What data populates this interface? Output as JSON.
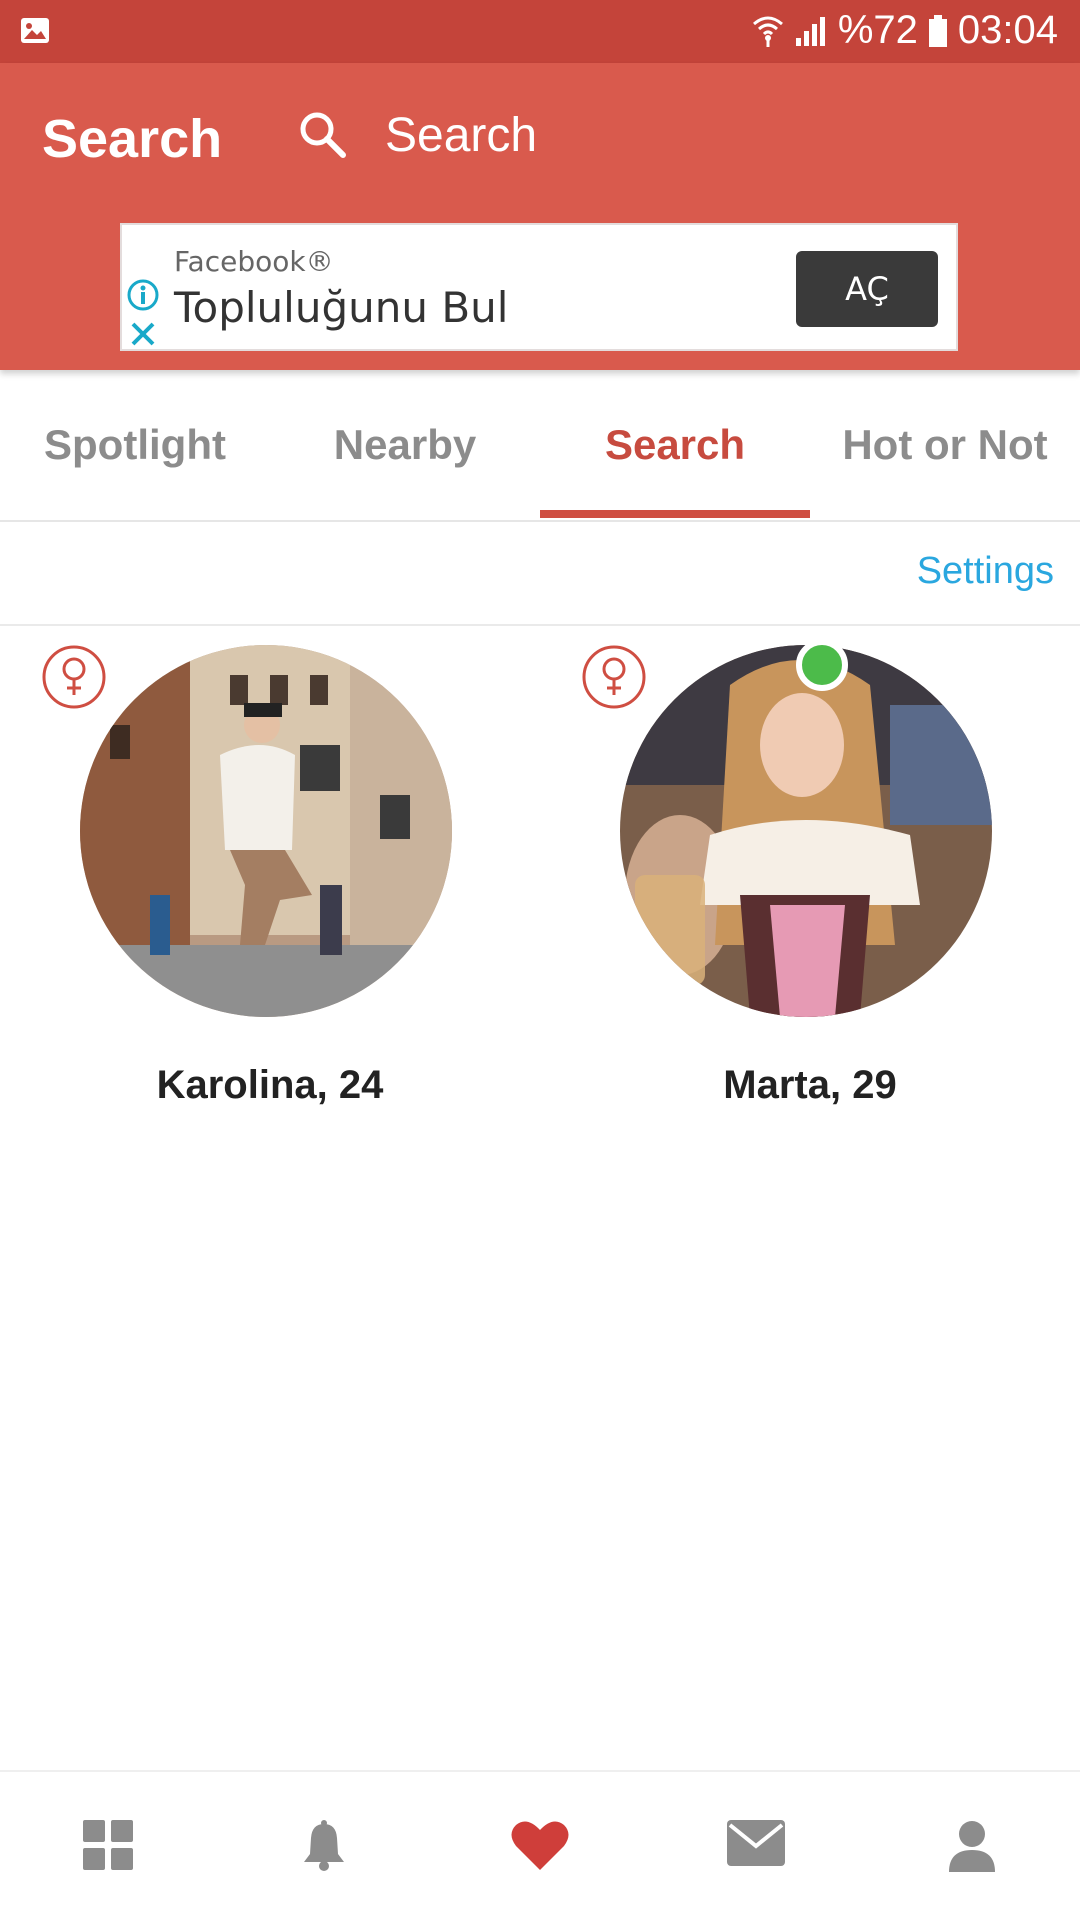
{
  "status_bar": {
    "battery": "%72",
    "time": "03:04",
    "icons": [
      "gallery-icon",
      "wifi-icon",
      "signal-icon",
      "battery-icon"
    ]
  },
  "header": {
    "title": "Search",
    "search_placeholder": "Search"
  },
  "ad": {
    "brand": "Facebook®",
    "headline": "Topluluğunu Bul",
    "cta": "AÇ"
  },
  "tabs": [
    {
      "label": "Spotlight",
      "active": false
    },
    {
      "label": "Nearby",
      "active": false
    },
    {
      "label": "Search",
      "active": true
    },
    {
      "label": "Hot or Not",
      "active": false
    }
  ],
  "settings_label": "Settings",
  "profiles": [
    {
      "name": "Karolina, 24",
      "gender": "female",
      "online": false
    },
    {
      "name": "Marta, 29",
      "gender": "female",
      "online": true
    }
  ],
  "bottom_nav": [
    {
      "icon": "grid-icon",
      "active": false
    },
    {
      "icon": "bell-icon",
      "active": false
    },
    {
      "icon": "heart-icon",
      "active": true
    },
    {
      "icon": "mail-icon",
      "active": false
    },
    {
      "icon": "profile-icon",
      "active": false
    }
  ],
  "colors": {
    "status_bar": "#c4443a",
    "app_bar": "#d95a4d",
    "accent": "#cf4e42",
    "link": "#2aa7df",
    "online": "#4cbb4a",
    "inactive": "#8c8c8c"
  }
}
